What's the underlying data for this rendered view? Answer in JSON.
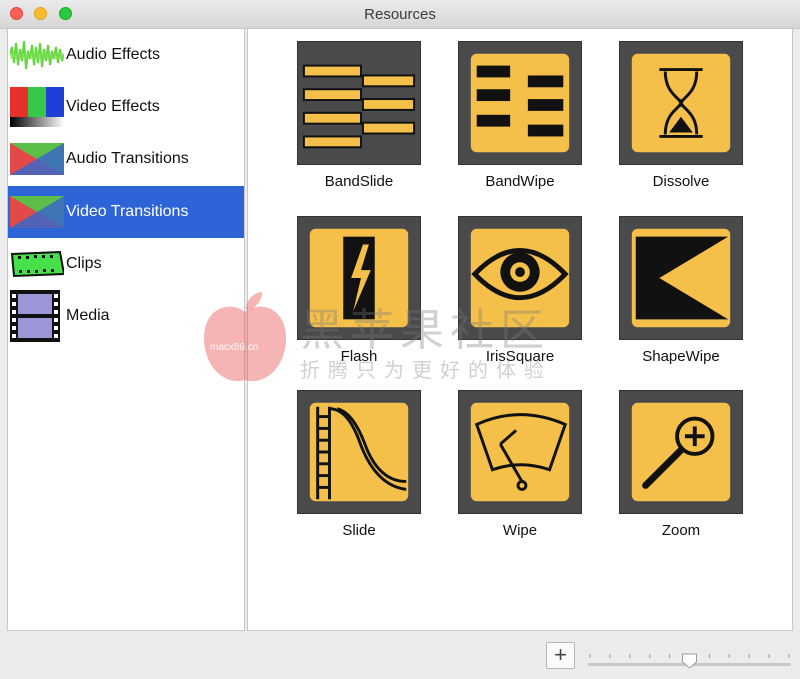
{
  "window": {
    "title": "Resources"
  },
  "sidebar": {
    "items": [
      {
        "label": "Audio Effects",
        "icon": "audio-waveform-icon",
        "selected": false
      },
      {
        "label": "Video Effects",
        "icon": "color-bars-icon",
        "selected": false
      },
      {
        "label": "Audio Transitions",
        "icon": "transition-triangles-icon",
        "selected": false
      },
      {
        "label": "Video Transitions",
        "icon": "transition-triangles-icon",
        "selected": true
      },
      {
        "label": "Clips",
        "icon": "film-clip-icon",
        "selected": false
      },
      {
        "label": "Media",
        "icon": "filmstrip-icon",
        "selected": false
      }
    ]
  },
  "transitions": {
    "items": [
      {
        "label": "BandSlide",
        "icon": "bandslide-icon"
      },
      {
        "label": "BandWipe",
        "icon": "bandwipe-icon"
      },
      {
        "label": "Dissolve",
        "icon": "hourglass-icon"
      },
      {
        "label": "Flash",
        "icon": "lightning-icon"
      },
      {
        "label": "IrisSquare",
        "icon": "eye-icon"
      },
      {
        "label": "ShapeWipe",
        "icon": "shape-wipe-icon"
      },
      {
        "label": "Slide",
        "icon": "slide-icon"
      },
      {
        "label": "Wipe",
        "icon": "wiper-icon"
      },
      {
        "label": "Zoom",
        "icon": "zoom-icon"
      }
    ]
  },
  "watermark": {
    "title": "黑苹果社区",
    "subtitle": "折腾只为更好的体验",
    "logo_text": "macx86.cn"
  },
  "footer": {
    "add_label": "+",
    "zoom_slider_level": 0.5
  },
  "colors": {
    "selection": "#2d64d8",
    "tile_gold": "#f4c04a",
    "tile_border": "#4a4a4a"
  }
}
